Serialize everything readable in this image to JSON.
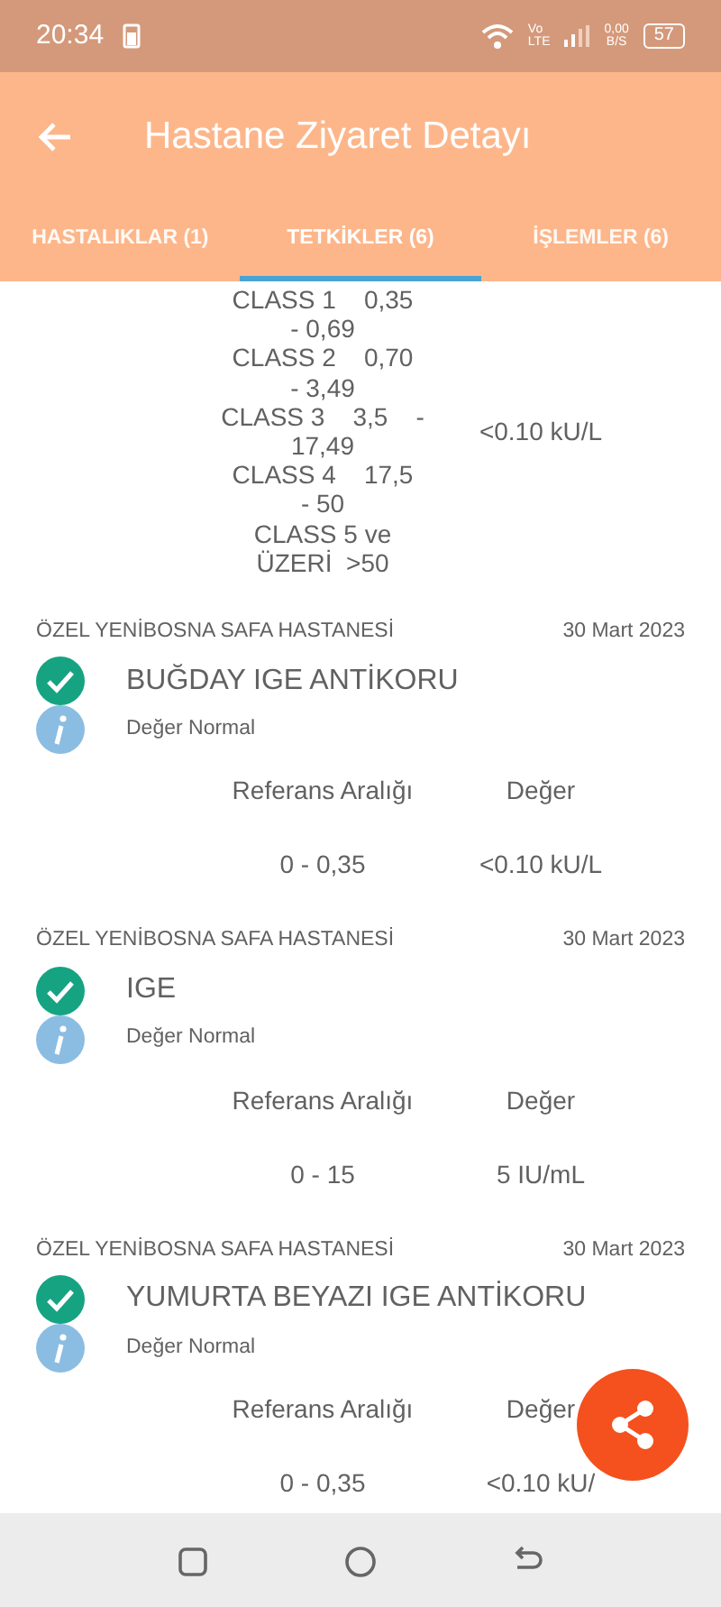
{
  "status_bar": {
    "time": "20:34",
    "volte_top": "Vo",
    "volte_bottom": "LTE",
    "speed_value": "0,00",
    "speed_unit": "B/S",
    "battery": "57"
  },
  "app_bar": {
    "title": "Hastane Ziyaret Detayı"
  },
  "tabs": [
    {
      "label": "HASTALIKLAR (1)",
      "selected": false
    },
    {
      "label": "TETKİKLER (6)",
      "selected": true
    },
    {
      "label": "İŞLEMLER (6)",
      "selected": false
    }
  ],
  "partial_result": {
    "reference_lines": [
      "CLASS 1    0,35",
      "- 0,69",
      "CLASS 2    0,70",
      "- 3,49",
      "CLASS 3    3,5    -",
      "17,49",
      "CLASS 4    17,5",
      "- 50",
      "CLASS 5 ve",
      "ÜZERİ  >50"
    ],
    "value": "<0.10 kU/L"
  },
  "results": [
    {
      "hospital": "ÖZEL YENİBOSNA SAFA HASTANESİ",
      "date": "30 Mart 2023",
      "test": "BUĞDAY IGE ANTİKORU",
      "status": "Değer Normal",
      "reference_header": "Referans Aralığı",
      "value_header": "Değer",
      "reference": "0 - 0,35",
      "value": "<0.10 kU/L"
    },
    {
      "hospital": "ÖZEL YENİBOSNA SAFA HASTANESİ",
      "date": "30 Mart 2023",
      "test": "IGE",
      "status": "Değer Normal",
      "reference_header": "Referans Aralığı",
      "value_header": "Değer",
      "reference": "0 - 15",
      "value": "5 IU/mL"
    },
    {
      "hospital": "ÖZEL YENİBOSNA SAFA HASTANESİ",
      "date": "30 Mart 2023",
      "test": "YUMURTA BEYAZI IGE ANTİKORU",
      "status": "Değer Normal",
      "reference_header": "Referans Aralığı",
      "value_header": "Değer",
      "reference": "0 - 0,35",
      "value": "<0.10 kU/"
    }
  ]
}
